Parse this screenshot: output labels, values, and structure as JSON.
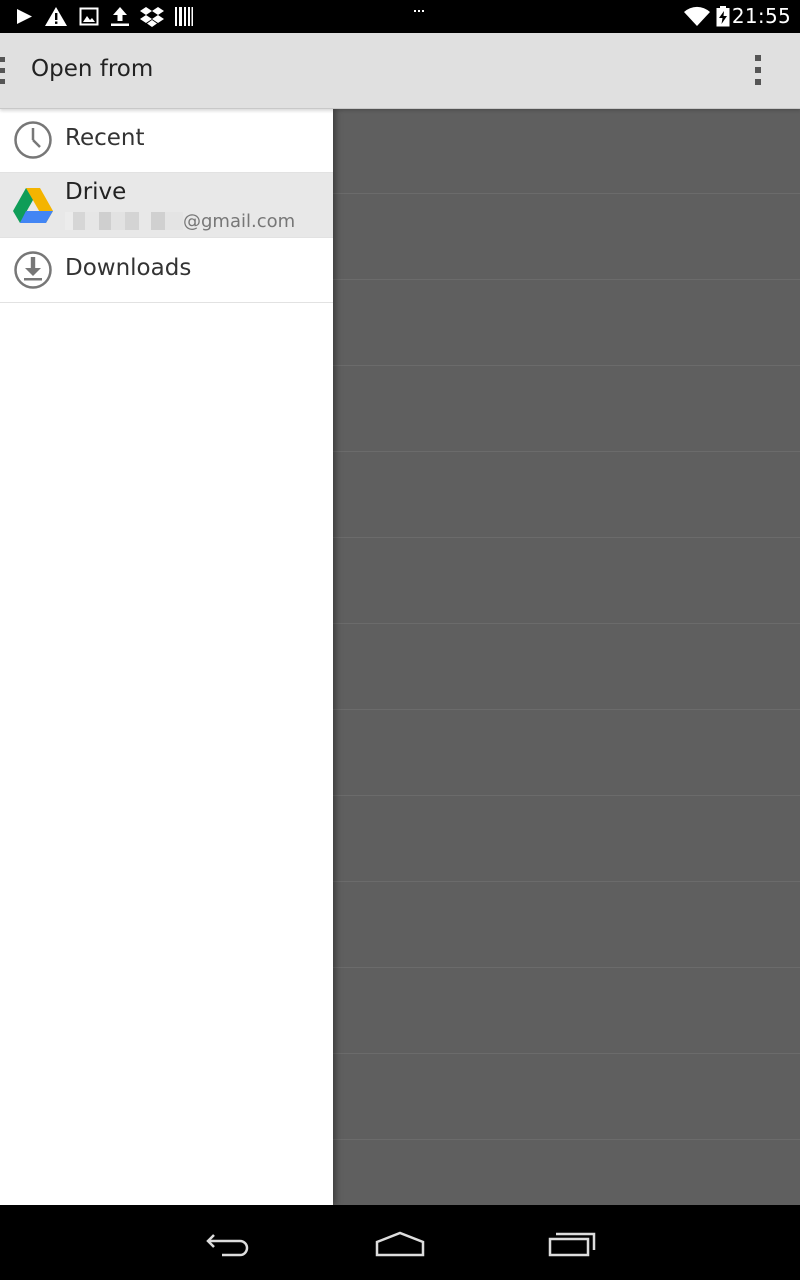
{
  "status_bar": {
    "time": "21:55",
    "icons": [
      "play-icon",
      "warning-icon",
      "image-icon",
      "upload-icon",
      "dropbox-icon",
      "barcode-icon",
      "wifi-icon",
      "battery-icon"
    ]
  },
  "action_bar": {
    "title": "Open from"
  },
  "drawer": {
    "roots": [
      {
        "label": "Recent",
        "icon": "clock-icon"
      },
      {
        "label": "Drive",
        "subtitle": "@gmail.com",
        "icon": "google-drive-icon"
      },
      {
        "label": "Downloads",
        "icon": "download-icon"
      }
    ]
  },
  "colors": {
    "action_bar_bg": "#e0e0e0",
    "drawer_bg": "#ffffff",
    "selected_row": "#e8e8e8",
    "scrim": "#5f5f5f",
    "drive_green": "#0f9d58",
    "drive_yellow": "#f4b400",
    "drive_blue": "#4285f4"
  }
}
